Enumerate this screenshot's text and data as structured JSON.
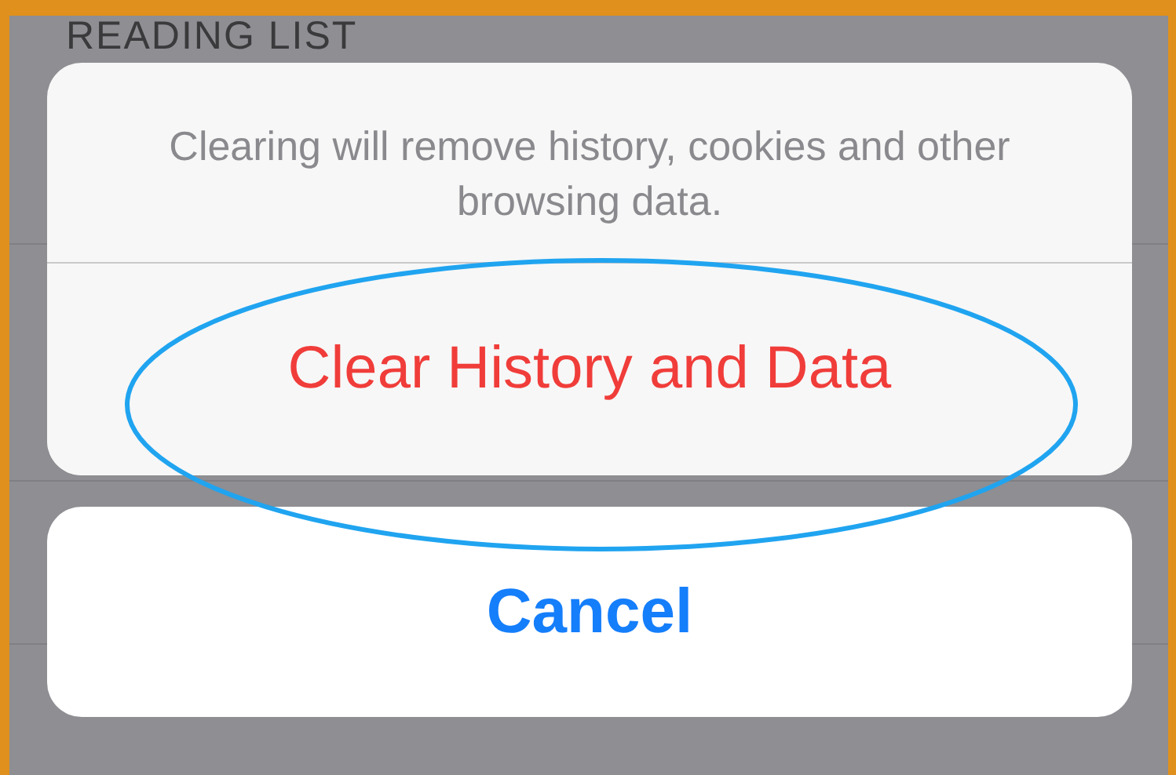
{
  "background": {
    "section_header": "READING LIST"
  },
  "action_sheet": {
    "message": "Clearing will remove history, cookies and other browsing data.",
    "actions": [
      {
        "label": "Clear History and Data",
        "kind": "destructive"
      }
    ],
    "cancel": {
      "label": "Cancel"
    }
  },
  "annotation": {
    "kind": "ellipse"
  }
}
